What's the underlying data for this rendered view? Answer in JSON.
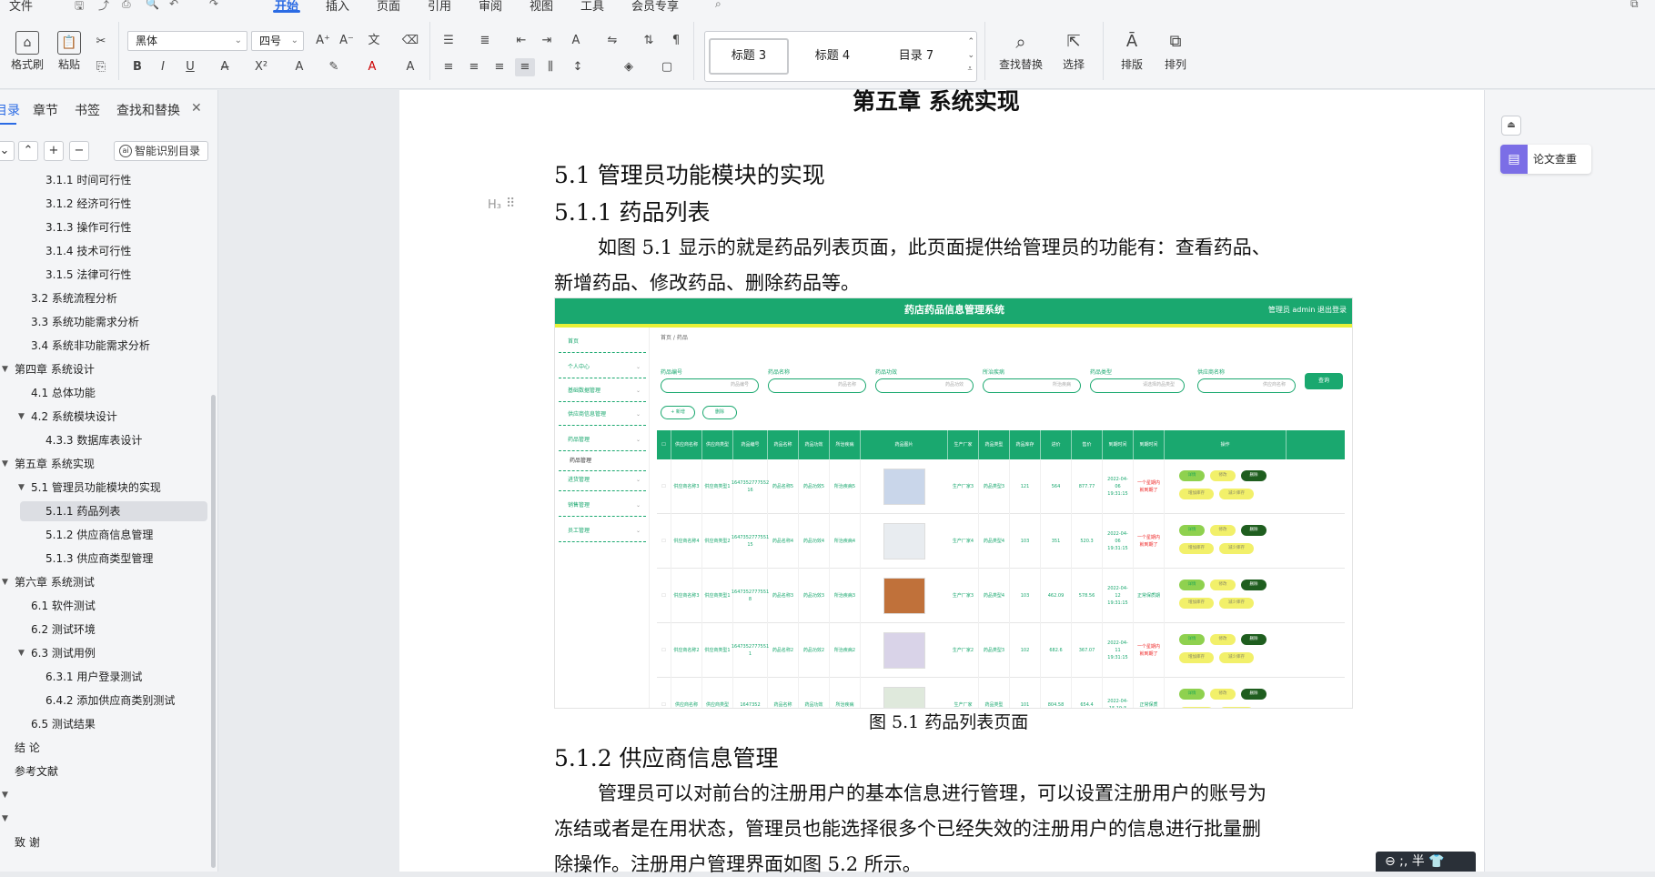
{
  "menubar": {
    "items": [
      "文件",
      "开始",
      "插入",
      "页面",
      "引用",
      "审阅",
      "视图",
      "工具",
      "会员专享"
    ],
    "active": "开始"
  },
  "ribbon": {
    "format_painter": "格式刷",
    "paste": "粘贴",
    "font_name": "黑体",
    "font_size": "四号",
    "styles": [
      "标题 3",
      "标题 4",
      "目录 7"
    ],
    "find_replace": "查找替换",
    "select": "选择",
    "layout": "排版",
    "arrange": "排列"
  },
  "nav": {
    "tabs": [
      "目录",
      "章节",
      "书签",
      "查找和替换"
    ],
    "active_tab": "目录",
    "smart_button": "智能识别目录",
    "toc": [
      {
        "label": "3.1.1  时间可行性",
        "level": 3
      },
      {
        "label": "3.1.2  经济可行性",
        "level": 3
      },
      {
        "label": "3.1.3  操作可行性",
        "level": 3
      },
      {
        "label": "3.1.4  技术可行性",
        "level": 3
      },
      {
        "label": "3.1.5  法律可行性",
        "level": 3
      },
      {
        "label": "3.2 系统流程分析",
        "level": 2
      },
      {
        "label": "3.3 系统功能需求分析",
        "level": 2
      },
      {
        "label": "3.4  系统非功能需求分析",
        "level": 2
      },
      {
        "label": "第四章  系统设计",
        "level": 1,
        "expanded": true
      },
      {
        "label": "4.1  总体功能",
        "level": 2
      },
      {
        "label": "4.2  系统模块设计",
        "level": 2,
        "expanded": true
      },
      {
        "label": "4.3.3  数据库表设计",
        "level": 3
      },
      {
        "label": "第五章  系统实现",
        "level": 1,
        "expanded": true
      },
      {
        "label": "5.1  管理员功能模块的实现",
        "level": 2,
        "expanded": true
      },
      {
        "label": "5.1.1  药品列表",
        "level": 3,
        "selected": true
      },
      {
        "label": "5.1.2  供应商信息管理",
        "level": 3
      },
      {
        "label": "5.1.3  供应商类型管理",
        "level": 3
      },
      {
        "label": "第六章  系统测试",
        "level": 1,
        "expanded": true
      },
      {
        "label": "6.1 软件测试",
        "level": 2
      },
      {
        "label": "6.2 测试环境",
        "level": 2
      },
      {
        "label": "6.3  测试用例",
        "level": 2,
        "expanded": true
      },
      {
        "label": "6.3.1  用户登录测试",
        "level": 3
      },
      {
        "label": "6.4.2  添加供应商类别测试",
        "level": 3
      },
      {
        "label": "6.5 测试结果",
        "level": 2
      },
      {
        "label": "结  论",
        "level": 1
      },
      {
        "label": "参考文献",
        "level": 1
      },
      {
        "label": "",
        "level": 1,
        "expanded": true
      },
      {
        "label": "",
        "level": 1,
        "expanded": true
      },
      {
        "label": "致  谢",
        "level": 1
      }
    ]
  },
  "doc": {
    "chapter_title": "第五章  系统实现",
    "h2": "5.1  管理员功能模块的实现",
    "h3_1": "5.1.1  药品列表",
    "heading_marker": "H₃",
    "para1_line1": "如图 5.1 显示的就是药品列表页面，此页面提供给管理员的功能有：查看药品、",
    "para1_line2": "新增药品、修改药品、删除药品等。",
    "caption": "图 5.1  药品列表页面",
    "h3_2": "5.1.2  供应商信息管理",
    "para2_line1": "管理员可以对前台的注册用户的基本信息进行管理，可以设置注册用户的账号为",
    "para2_line2": "冻结或者是在用状态，管理员也能选择很多个已经失效的注册用户的信息进行批量删",
    "para2_line3": "除操作。注册用户管理界面如图 5.2 所示。"
  },
  "figure": {
    "app_title": "药店药品信息管理系统",
    "admin_text": "管理员 admin    退出登录",
    "sidebar": [
      "首页",
      "个人中心",
      "基础数据管理",
      "供应商信息管理",
      "药品管理",
      "药品管理",
      "进货管理",
      "销售管理",
      "员工管理"
    ],
    "breadcrumb": "首页 / 药品",
    "filters": [
      {
        "label": "药品编号",
        "placeholder": "药品编号"
      },
      {
        "label": "药品名称",
        "placeholder": "药品名称"
      },
      {
        "label": "药品功效",
        "placeholder": "药品功效"
      },
      {
        "label": "所治疾病",
        "placeholder": "所治疾病"
      },
      {
        "label": "药品类型",
        "placeholder": "请选择药品类型"
      },
      {
        "label": "供应商名称",
        "placeholder": "供应商名称"
      }
    ],
    "search_button": "查询",
    "add_button": "+ 新增",
    "delete_button": "删除",
    "columns": [
      "",
      "供应商名称",
      "供应商类型",
      "药品编号",
      "药品名称",
      "药品功效",
      "所治疾病",
      "药品图片",
      "生产厂家",
      "药品类型",
      "药品库存",
      "进价",
      "售价",
      "到期时间",
      "到期时间",
      "操作"
    ],
    "rows": [
      {
        "supplier": "供应商名称3",
        "stype": "供应商类型1",
        "code": "1647352777552 16",
        "name": "药品名称5",
        "effect": "药品功效5",
        "disease": "所治疾病5",
        "maker": "生产厂家3",
        "type": "药品类型3",
        "stock": "121",
        "in_price": "564",
        "price": "877.77",
        "expire": "2022-04-06 19:31:15",
        "status": "一个星期内就到期了",
        "status_red": true
      },
      {
        "supplier": "供应商名称4",
        "stype": "供应商类型2",
        "code": "1647352777551 15",
        "name": "药品名称4",
        "effect": "药品功效4",
        "disease": "所治疾病4",
        "maker": "生产厂家4",
        "type": "药品类型4",
        "stock": "103",
        "in_price": "351",
        "price": "520.3",
        "expire": "2022-04-06 19:31:15",
        "status": "一个星期内就到期了",
        "status_red": true
      },
      {
        "supplier": "供应商名称3",
        "stype": "供应商类型1",
        "code": "1647352777551 8",
        "name": "药品名称3",
        "effect": "药品功效3",
        "disease": "所治疾病3",
        "maker": "生产厂家3",
        "type": "药品类型4",
        "stock": "103",
        "in_price": "462.09",
        "price": "578.56",
        "expire": "2022-04-12 19:31:15",
        "status": "正常保质期",
        "status_red": false
      },
      {
        "supplier": "供应商名称2",
        "stype": "供应商类型1",
        "code": "1647352777551 1",
        "name": "药品名称2",
        "effect": "药品功效2",
        "disease": "所治疾病2",
        "maker": "生产厂家2",
        "type": "药品类型3",
        "stock": "102",
        "in_price": "682.6",
        "price": "367.07",
        "expire": "2022-04-11 19:31:15",
        "status": "一个星期内就到期了",
        "status_red": true
      },
      {
        "supplier": "供应商名称",
        "stype": "供应商类型",
        "code": "1647352",
        "name": "药品名称",
        "effect": "药品功效",
        "disease": "所治疾病",
        "maker": "生产厂家",
        "type": "药品类型",
        "stock": "101",
        "in_price": "804.58",
        "price": "654.4",
        "expire": "2022-04-15 19:3",
        "status": "正常保质",
        "status_red": false
      }
    ],
    "actions": {
      "view": "详情",
      "edit": "修改",
      "del": "删除",
      "add_stock": "增加库存",
      "reduce_stock": "减少库存"
    }
  },
  "right_panel": {
    "check_button": "论文查重"
  },
  "ime": {
    "text": "⊖ ;, 半 👕"
  },
  "colors": {
    "accent": "#2b6be4",
    "app_green": "#1aa86f",
    "app_yellow": "#e8f037"
  }
}
